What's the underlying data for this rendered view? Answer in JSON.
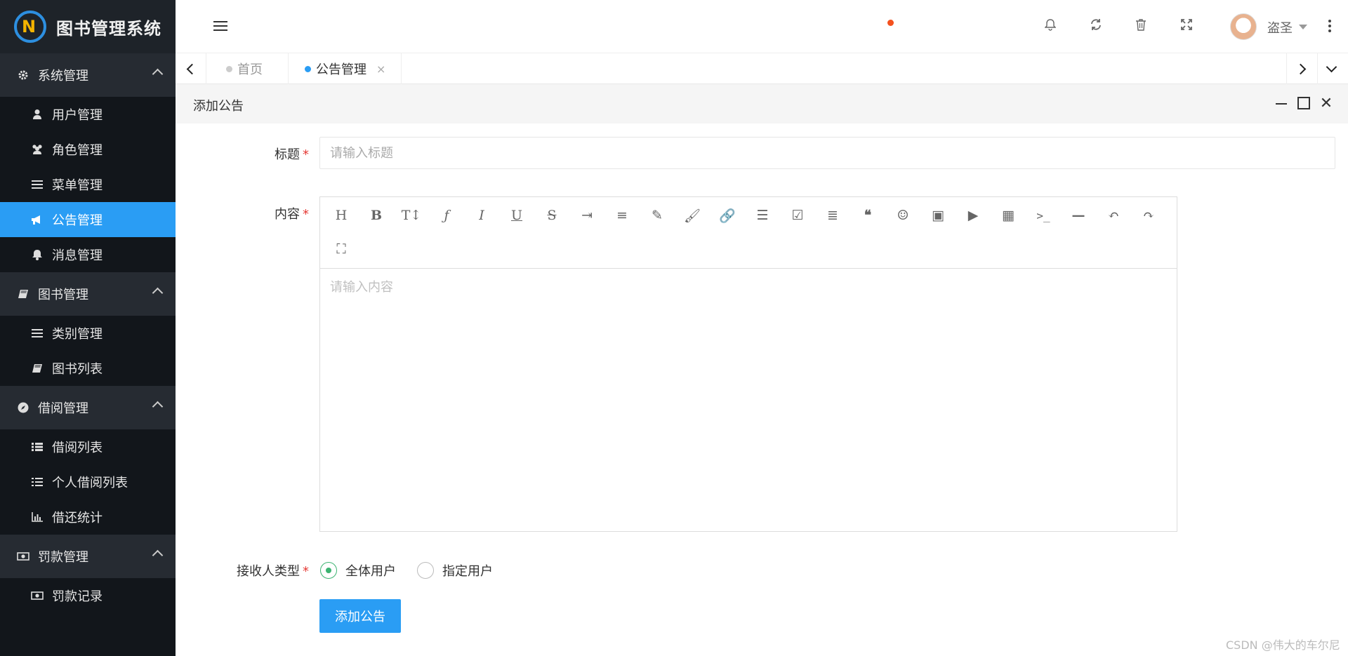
{
  "app": {
    "title": "图书管理系统"
  },
  "sidebar": {
    "groups": [
      {
        "label": "系统管理",
        "icon": "gear-icon",
        "items": [
          {
            "label": "用户管理",
            "icon": "user-icon"
          },
          {
            "label": "角色管理",
            "icon": "users-icon"
          },
          {
            "label": "菜单管理",
            "icon": "bars-icon"
          },
          {
            "label": "公告管理",
            "icon": "bullhorn-icon",
            "active": true
          },
          {
            "label": "消息管理",
            "icon": "bell-icon"
          }
        ]
      },
      {
        "label": "图书管理",
        "icon": "book-icon",
        "items": [
          {
            "label": "类别管理",
            "icon": "bars-icon"
          },
          {
            "label": "图书列表",
            "icon": "book-icon"
          }
        ]
      },
      {
        "label": "借阅管理",
        "icon": "compass-icon",
        "items": [
          {
            "label": "借阅列表",
            "icon": "list-icon"
          },
          {
            "label": "个人借阅列表",
            "icon": "list-icon"
          },
          {
            "label": "借还统计",
            "icon": "bar-chart-icon"
          }
        ]
      },
      {
        "label": "罚款管理",
        "icon": "money-icon",
        "items": [
          {
            "label": "罚款记录",
            "icon": "money-icon"
          }
        ]
      }
    ]
  },
  "header": {
    "username": "盗圣",
    "notification_dot_color": "#f4511e"
  },
  "tabs": [
    {
      "label": "首页",
      "active": false
    },
    {
      "label": "公告管理",
      "active": true,
      "close": "×"
    }
  ],
  "panel": {
    "title": "添加公告"
  },
  "form": {
    "title_label": "标题",
    "title_placeholder": "请输入标题",
    "content_label": "内容",
    "content_placeholder": "请输入内容",
    "receiver_label": "接收人类型",
    "required_mark": "*",
    "receiver_options": [
      {
        "label": "全体用户",
        "checked": true
      },
      {
        "label": "指定用户",
        "checked": false
      }
    ],
    "submit_label": "添加公告"
  },
  "editor_toolbar": [
    "heading-icon",
    "bold-icon",
    "font-size-icon",
    "font-icon",
    "italic-icon",
    "underline-icon",
    "strikethrough-icon",
    "indent-icon",
    "line-height-icon",
    "pencil-icon",
    "brush-icon",
    "link-icon",
    "list-icon",
    "checkbox-icon",
    "align-icon",
    "quote-icon",
    "emoji-icon",
    "image-icon",
    "video-icon",
    "table-icon",
    "code-icon",
    "hr-icon",
    "undo-icon",
    "redo-icon",
    "fullscreen-icon"
  ],
  "watermark": "CSDN @伟大的车尔尼",
  "colors": {
    "accent": "#2a9df4",
    "sidebar_bg": "#12161b",
    "sidebar_group_bg": "#262b32",
    "radio_checked": "#3cb371",
    "required": "#e53935"
  }
}
